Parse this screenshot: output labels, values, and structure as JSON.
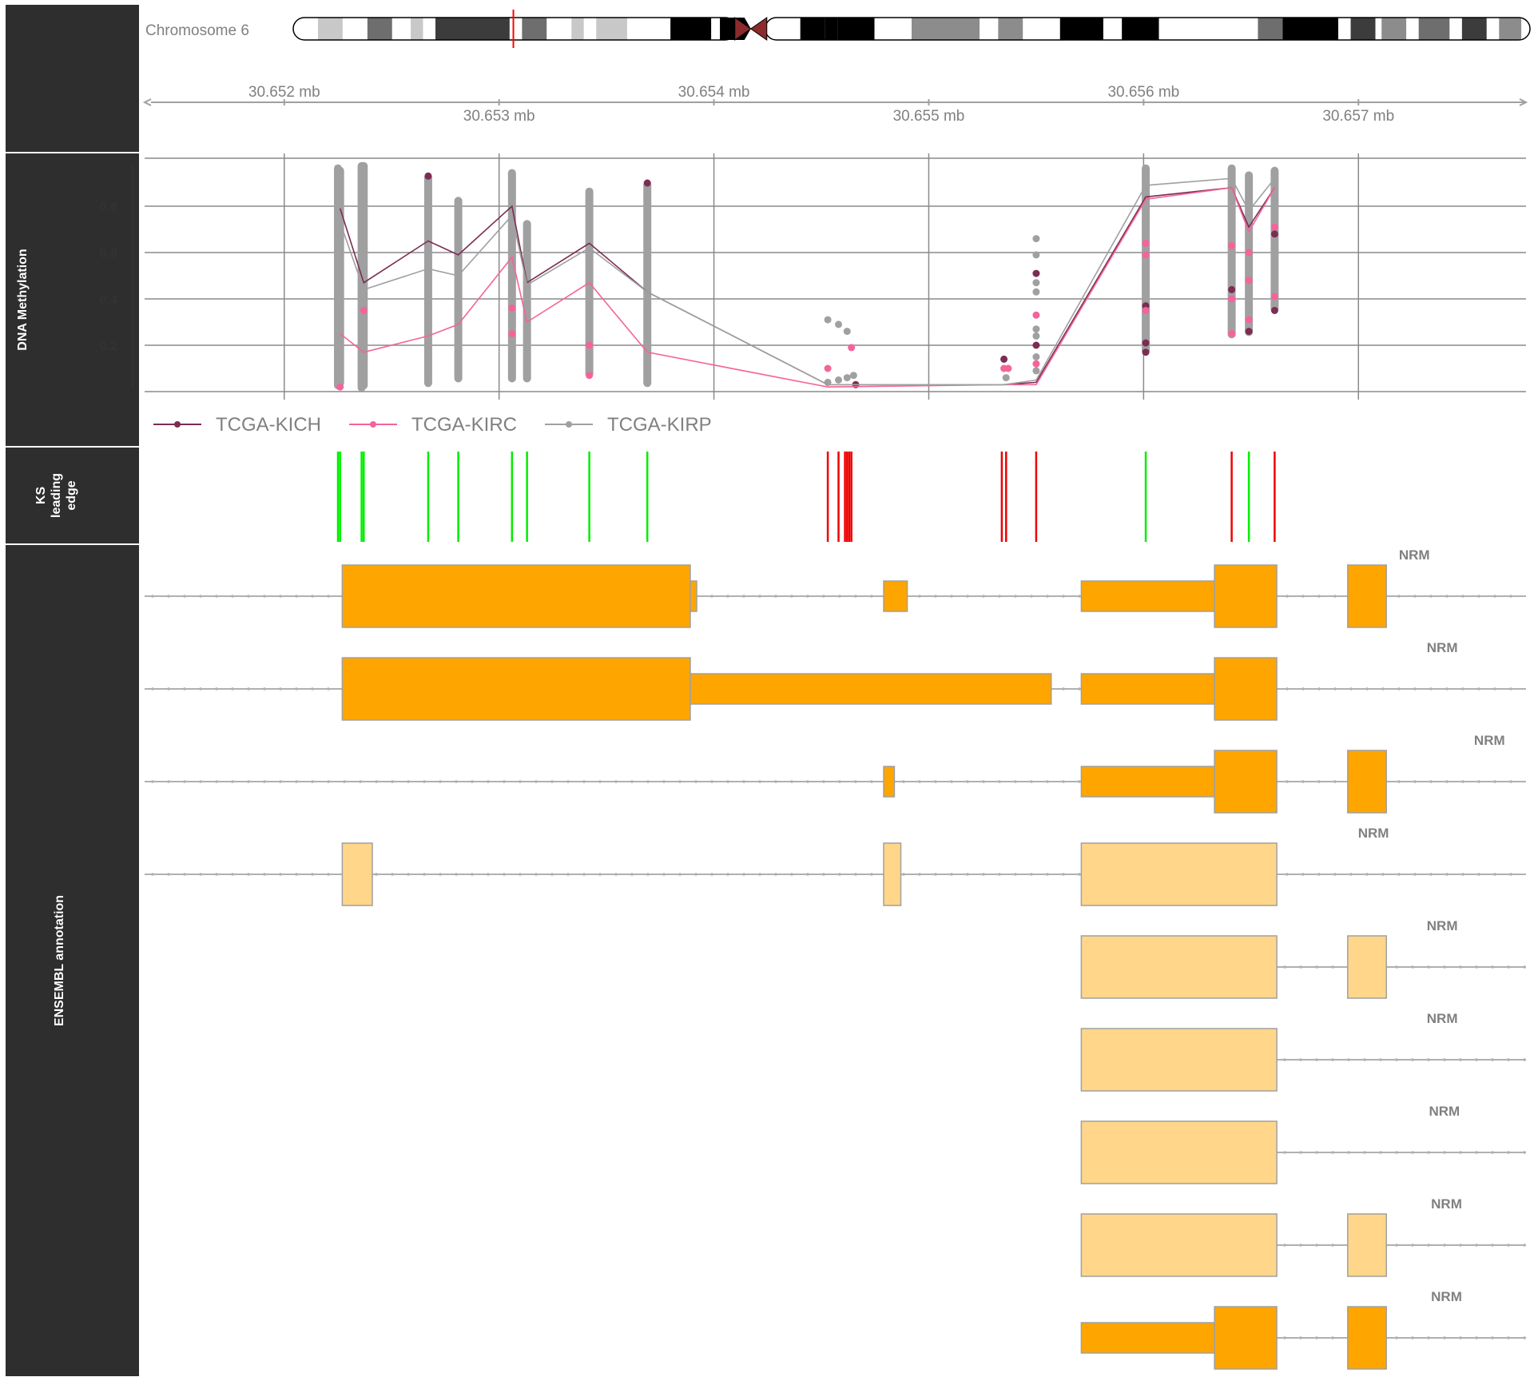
{
  "ideogram": {
    "label": "Chromosome 6",
    "colors": {
      "outline": "#000000",
      "highlight": "#ff0000",
      "centromere": "#8b2b2b"
    },
    "bands": [
      {
        "start": 0.0,
        "end": 0.02,
        "stain": "gneg"
      },
      {
        "start": 0.02,
        "end": 0.04,
        "stain": "gpos25"
      },
      {
        "start": 0.04,
        "end": 0.06,
        "stain": "gneg"
      },
      {
        "start": 0.06,
        "end": 0.08,
        "stain": "gpos75"
      },
      {
        "start": 0.08,
        "end": 0.095,
        "stain": "gneg"
      },
      {
        "start": 0.095,
        "end": 0.105,
        "stain": "gpos25"
      },
      {
        "start": 0.105,
        "end": 0.115,
        "stain": "gneg"
      },
      {
        "start": 0.115,
        "end": 0.175,
        "stain": "gpos90"
      },
      {
        "start": 0.175,
        "end": 0.185,
        "stain": "gneg"
      },
      {
        "start": 0.185,
        "end": 0.205,
        "stain": "gpos75"
      },
      {
        "start": 0.205,
        "end": 0.225,
        "stain": "gneg"
      },
      {
        "start": 0.225,
        "end": 0.235,
        "stain": "gpos25"
      },
      {
        "start": 0.235,
        "end": 0.245,
        "stain": "gneg"
      },
      {
        "start": 0.245,
        "end": 0.27,
        "stain": "gpos25"
      },
      {
        "start": 0.27,
        "end": 0.27,
        "stain": "gneg"
      },
      {
        "start": 0.27,
        "end": 0.305,
        "stain": "gneg"
      },
      {
        "start": 0.305,
        "end": 0.338,
        "stain": "gpos100"
      },
      {
        "start": 0.338,
        "end": 0.345,
        "stain": "gneg"
      },
      {
        "start": 0.345,
        "end": 0.37,
        "stain": "gpos100"
      },
      {
        "start": 0.37,
        "end": 0.38,
        "stain": "gneg"
      },
      {
        "start": 0.41,
        "end": 0.43,
        "stain": "gpos100"
      },
      {
        "start": 0.43,
        "end": 0.44,
        "stain": "gpos100"
      },
      {
        "start": 0.44,
        "end": 0.47,
        "stain": "gpos100"
      },
      {
        "start": 0.47,
        "end": 0.5,
        "stain": "gneg"
      },
      {
        "start": 0.5,
        "end": 0.555,
        "stain": "gpos50"
      },
      {
        "start": 0.555,
        "end": 0.57,
        "stain": "gneg"
      },
      {
        "start": 0.57,
        "end": 0.59,
        "stain": "gpos50"
      },
      {
        "start": 0.59,
        "end": 0.62,
        "stain": "gneg"
      },
      {
        "start": 0.62,
        "end": 0.655,
        "stain": "gpos100"
      },
      {
        "start": 0.655,
        "end": 0.67,
        "stain": "gneg"
      },
      {
        "start": 0.67,
        "end": 0.7,
        "stain": "gpos100"
      },
      {
        "start": 0.7,
        "end": 0.78,
        "stain": "gneg"
      },
      {
        "start": 0.78,
        "end": 0.8,
        "stain": "gpos75"
      },
      {
        "start": 0.8,
        "end": 0.845,
        "stain": "gpos100"
      },
      {
        "start": 0.845,
        "end": 0.855,
        "stain": "gneg"
      },
      {
        "start": 0.855,
        "end": 0.875,
        "stain": "gpos90"
      },
      {
        "start": 0.875,
        "end": 0.88,
        "stain": "gneg"
      },
      {
        "start": 0.88,
        "end": 0.9,
        "stain": "gpos50"
      },
      {
        "start": 0.9,
        "end": 0.91,
        "stain": "gneg"
      },
      {
        "start": 0.91,
        "end": 0.935,
        "stain": "gpos75"
      },
      {
        "start": 0.935,
        "end": 0.945,
        "stain": "gneg"
      },
      {
        "start": 0.945,
        "end": 0.965,
        "stain": "gpos90"
      },
      {
        "start": 0.965,
        "end": 0.975,
        "stain": "gneg"
      },
      {
        "start": 0.975,
        "end": 0.993,
        "stain": "gpos50"
      },
      {
        "start": 0.993,
        "end": 1.0,
        "stain": "gneg"
      }
    ],
    "centromere": 0.37,
    "highlight_at": 0.178
  },
  "stain_colors": {
    "gneg": "#ffffff",
    "gpos25": "#c8c8c8",
    "gpos50": "#8c8c8c",
    "gpos75": "#6e6e6e",
    "gpos90": "#3c3c3c",
    "gpos100": "#000000"
  },
  "axis": {
    "unit": "mb",
    "range": [
      30.65135,
      30.65778
    ],
    "ticks": [
      {
        "value": 30.652,
        "label": "30.652 mb",
        "row": "top"
      },
      {
        "value": 30.653,
        "label": "30.653 mb",
        "row": "bottom"
      },
      {
        "value": 30.654,
        "label": "30.654 mb",
        "row": "top"
      },
      {
        "value": 30.655,
        "label": "30.655 mb",
        "row": "bottom"
      },
      {
        "value": 30.656,
        "label": "30.656 mb",
        "row": "top"
      },
      {
        "value": 30.657,
        "label": "30.657 mb",
        "row": "bottom"
      }
    ]
  },
  "panels": {
    "methylation": "DNA Methylation",
    "ks": [
      "KS",
      "leading",
      "edge"
    ],
    "annotation": "ENSEMBL annotation"
  },
  "chart_data": {
    "type": "line",
    "title": "",
    "xlabel": "",
    "ylabel": "DNA Methylation",
    "ylim": [
      0,
      1
    ],
    "yticks": [
      0.2,
      0.4,
      0.6,
      0.8
    ],
    "grid": true,
    "legend_position": "bottom",
    "x": [
      30.65226,
      30.65237,
      30.65267,
      30.65281,
      30.65306,
      30.65313,
      30.65342,
      30.65369,
      30.65453,
      30.65535,
      30.6555,
      30.65601,
      30.65641,
      30.65649,
      30.65661
    ],
    "series": [
      {
        "name": "TCGA-KICH",
        "color": "#7b2d53",
        "values": [
          0.79,
          0.47,
          0.65,
          0.59,
          0.8,
          0.47,
          0.64,
          0.43,
          0.03,
          0.03,
          0.04,
          0.84,
          0.88,
          0.71,
          0.88
        ]
      },
      {
        "name": "TCGA-KIRC",
        "color": "#f4649a",
        "values": [
          0.25,
          0.17,
          0.24,
          0.29,
          0.58,
          0.3,
          0.47,
          0.17,
          0.02,
          0.03,
          0.03,
          0.83,
          0.88,
          0.69,
          0.88
        ]
      },
      {
        "name": "TCGA-KIRP",
        "color": "#a0a0a0",
        "values": [
          0.73,
          0.44,
          0.53,
          0.5,
          0.76,
          0.46,
          0.62,
          0.43,
          0.03,
          0.03,
          0.05,
          0.89,
          0.92,
          0.78,
          0.92
        ]
      }
    ],
    "scatter_columns": [
      {
        "x": 30.65225,
        "min": 0.02,
        "max": 0.97
      },
      {
        "x": 30.65226,
        "min": 0.03,
        "max": 0.96
      },
      {
        "x": 30.65236,
        "min": 0.01,
        "max": 0.98
      },
      {
        "x": 30.65237,
        "min": 0.02,
        "max": 0.98
      },
      {
        "x": 30.65267,
        "min": 0.03,
        "max": 0.93
      },
      {
        "x": 30.65281,
        "min": 0.05,
        "max": 0.83
      },
      {
        "x": 30.65306,
        "min": 0.05,
        "max": 0.95
      },
      {
        "x": 30.65313,
        "min": 0.05,
        "max": 0.73
      },
      {
        "x": 30.65342,
        "min": 0.07,
        "max": 0.87
      },
      {
        "x": 30.65369,
        "min": 0.03,
        "max": 0.9
      },
      {
        "x": 30.65601,
        "min": 0.17,
        "max": 0.97
      },
      {
        "x": 30.65641,
        "min": 0.24,
        "max": 0.97
      },
      {
        "x": 30.65649,
        "min": 0.25,
        "max": 0.94
      },
      {
        "x": 30.65661,
        "min": 0.35,
        "max": 0.96
      }
    ],
    "scatter_points": [
      {
        "x": 30.65453,
        "y": 0.31,
        "series": 2
      },
      {
        "x": 30.65458,
        "y": 0.29,
        "series": 2
      },
      {
        "x": 30.65462,
        "y": 0.26,
        "series": 2
      },
      {
        "x": 30.65464,
        "y": 0.19,
        "series": 1
      },
      {
        "x": 30.65453,
        "y": 0.1,
        "series": 1
      },
      {
        "x": 30.65453,
        "y": 0.04,
        "series": 2
      },
      {
        "x": 30.65458,
        "y": 0.05,
        "series": 2
      },
      {
        "x": 30.65462,
        "y": 0.06,
        "series": 2
      },
      {
        "x": 30.65465,
        "y": 0.07,
        "series": 2
      },
      {
        "x": 30.65466,
        "y": 0.03,
        "series": 0
      },
      {
        "x": 30.65535,
        "y": 0.14,
        "series": 0
      },
      {
        "x": 30.65535,
        "y": 0.1,
        "series": 1
      },
      {
        "x": 30.65537,
        "y": 0.1,
        "series": 1
      },
      {
        "x": 30.65536,
        "y": 0.06,
        "series": 2
      },
      {
        "x": 30.6555,
        "y": 0.66,
        "series": 2
      },
      {
        "x": 30.6555,
        "y": 0.59,
        "series": 2
      },
      {
        "x": 30.6555,
        "y": 0.51,
        "series": 0
      },
      {
        "x": 30.6555,
        "y": 0.47,
        "series": 2
      },
      {
        "x": 30.6555,
        "y": 0.43,
        "series": 2
      },
      {
        "x": 30.6555,
        "y": 0.33,
        "series": 1
      },
      {
        "x": 30.6555,
        "y": 0.27,
        "series": 2
      },
      {
        "x": 30.6555,
        "y": 0.24,
        "series": 2
      },
      {
        "x": 30.6555,
        "y": 0.2,
        "series": 0
      },
      {
        "x": 30.6555,
        "y": 0.15,
        "series": 2
      },
      {
        "x": 30.6555,
        "y": 0.12,
        "series": 1
      },
      {
        "x": 30.6555,
        "y": 0.09,
        "series": 2
      },
      {
        "x": 30.65601,
        "y": 0.37,
        "series": 0
      },
      {
        "x": 30.65601,
        "y": 0.35,
        "series": 1
      },
      {
        "x": 30.65601,
        "y": 0.21,
        "series": 0
      },
      {
        "x": 30.65601,
        "y": 0.17,
        "series": 0
      },
      {
        "x": 30.65601,
        "y": 0.64,
        "series": 1
      },
      {
        "x": 30.65601,
        "y": 0.59,
        "series": 1
      },
      {
        "x": 30.65641,
        "y": 0.25,
        "series": 1
      },
      {
        "x": 30.65641,
        "y": 0.4,
        "series": 1
      },
      {
        "x": 30.65641,
        "y": 0.44,
        "series": 0
      },
      {
        "x": 30.65641,
        "y": 0.63,
        "series": 1
      },
      {
        "x": 30.65649,
        "y": 0.26,
        "series": 0
      },
      {
        "x": 30.65649,
        "y": 0.31,
        "series": 1
      },
      {
        "x": 30.65649,
        "y": 0.48,
        "series": 1
      },
      {
        "x": 30.65649,
        "y": 0.6,
        "series": 1
      },
      {
        "x": 30.65661,
        "y": 0.35,
        "series": 0
      },
      {
        "x": 30.65661,
        "y": 0.41,
        "series": 1
      },
      {
        "x": 30.65661,
        "y": 0.68,
        "series": 0
      },
      {
        "x": 30.65661,
        "y": 0.71,
        "series": 1
      },
      {
        "x": 30.65226,
        "y": 0.02,
        "series": 1
      },
      {
        "x": 30.65237,
        "y": 0.35,
        "series": 1
      },
      {
        "x": 30.65306,
        "y": 0.36,
        "series": 1
      },
      {
        "x": 30.65306,
        "y": 0.25,
        "series": 1
      },
      {
        "x": 30.65342,
        "y": 0.2,
        "series": 1
      },
      {
        "x": 30.65342,
        "y": 0.07,
        "series": 1
      },
      {
        "x": 30.65369,
        "y": 0.9,
        "series": 0
      },
      {
        "x": 30.65267,
        "y": 0.93,
        "series": 0
      }
    ]
  },
  "ks_edges": {
    "colors": {
      "up": "#00ee00",
      "down": "#ee0000"
    },
    "positions": [
      {
        "x": 30.65225,
        "dir": "up"
      },
      {
        "x": 30.65226,
        "dir": "up"
      },
      {
        "x": 30.65236,
        "dir": "up"
      },
      {
        "x": 30.65237,
        "dir": "up"
      },
      {
        "x": 30.65267,
        "dir": "up"
      },
      {
        "x": 30.65281,
        "dir": "up"
      },
      {
        "x": 30.65306,
        "dir": "up"
      },
      {
        "x": 30.65313,
        "dir": "up"
      },
      {
        "x": 30.65342,
        "dir": "up"
      },
      {
        "x": 30.65369,
        "dir": "up"
      },
      {
        "x": 30.65453,
        "dir": "down"
      },
      {
        "x": 30.65458,
        "dir": "down"
      },
      {
        "x": 30.65461,
        "dir": "down"
      },
      {
        "x": 30.65462,
        "dir": "down"
      },
      {
        "x": 30.65463,
        "dir": "down"
      },
      {
        "x": 30.65464,
        "dir": "down"
      },
      {
        "x": 30.65534,
        "dir": "down"
      },
      {
        "x": 30.65536,
        "dir": "down"
      },
      {
        "x": 30.6555,
        "dir": "down"
      },
      {
        "x": 30.65601,
        "dir": "up"
      },
      {
        "x": 30.65641,
        "dir": "down"
      },
      {
        "x": 30.65649,
        "dir": "up"
      },
      {
        "x": 30.65661,
        "dir": "down"
      }
    ]
  },
  "transcripts": {
    "colors": {
      "coding": "#ffa500",
      "noncoding": "#ffd68a",
      "border": "#a0a0a0",
      "intron": "#b0b0b0"
    },
    "rows": [
      {
        "label": "NRM",
        "label_x": 30.65726,
        "intron": [
          30.65135,
          30.65778
        ],
        "exons": [
          {
            "s": 30.65227,
            "e": 30.65389,
            "t": "cds"
          },
          {
            "s": 30.65389,
            "e": 30.65392,
            "t": "utr"
          },
          {
            "s": 30.65479,
            "e": 30.6549,
            "t": "utr"
          },
          {
            "s": 30.65571,
            "e": 30.65633,
            "t": "utr"
          },
          {
            "s": 30.65633,
            "e": 30.65662,
            "t": "cds"
          },
          {
            "s": 30.65695,
            "e": 30.65713,
            "t": "cds"
          }
        ]
      },
      {
        "label": "NRM",
        "label_x": 30.65739,
        "intron": [
          30.65135,
          30.65778
        ],
        "exons": [
          {
            "s": 30.65227,
            "e": 30.65389,
            "t": "cds"
          },
          {
            "s": 30.65389,
            "e": 30.65557,
            "t": "utr"
          },
          {
            "s": 30.65571,
            "e": 30.65633,
            "t": "utr"
          },
          {
            "s": 30.65633,
            "e": 30.65662,
            "t": "cds"
          }
        ]
      },
      {
        "label": "NRM",
        "label_x": 30.65761,
        "intron": [
          30.65135,
          30.65778
        ],
        "exons": [
          {
            "s": 30.65479,
            "e": 30.65484,
            "t": "utr"
          },
          {
            "s": 30.65571,
            "e": 30.65633,
            "t": "utr"
          },
          {
            "s": 30.65633,
            "e": 30.65662,
            "t": "cds"
          },
          {
            "s": 30.65695,
            "e": 30.65713,
            "t": "cds"
          }
        ]
      },
      {
        "label": "NRM",
        "label_x": 30.65707,
        "intron": [
          30.65135,
          30.65778
        ],
        "exons": [
          {
            "s": 30.65227,
            "e": 30.65241,
            "t": "nc"
          },
          {
            "s": 30.65479,
            "e": 30.65487,
            "t": "nc"
          },
          {
            "s": 30.65571,
            "e": 30.65662,
            "t": "nc"
          }
        ]
      },
      {
        "label": "NRM",
        "label_x": 30.65739,
        "intron": [
          30.65662,
          30.65778
        ],
        "exons": [
          {
            "s": 30.65571,
            "e": 30.65662,
            "t": "nc"
          },
          {
            "s": 30.65695,
            "e": 30.65713,
            "t": "nc"
          }
        ]
      },
      {
        "label": "NRM",
        "label_x": 30.65739,
        "intron": [
          30.65662,
          30.65778
        ],
        "exons": [
          {
            "s": 30.65571,
            "e": 30.65662,
            "t": "nc"
          }
        ]
      },
      {
        "label": "NRM",
        "label_x": 30.6574,
        "intron": [
          30.65662,
          30.65778
        ],
        "exons": [
          {
            "s": 30.65571,
            "e": 30.65662,
            "t": "nc"
          }
        ]
      },
      {
        "label": "NRM",
        "label_x": 30.65741,
        "intron": [
          30.65662,
          30.65778
        ],
        "exons": [
          {
            "s": 30.65571,
            "e": 30.65662,
            "t": "nc"
          },
          {
            "s": 30.65695,
            "e": 30.65713,
            "t": "nc"
          }
        ]
      },
      {
        "label": "NRM",
        "label_x": 30.65741,
        "intron": [
          30.65662,
          30.65778
        ],
        "exons": [
          {
            "s": 30.65571,
            "e": 30.65633,
            "t": "utr"
          },
          {
            "s": 30.65633,
            "e": 30.65662,
            "t": "cds"
          },
          {
            "s": 30.65695,
            "e": 30.65713,
            "t": "cds"
          }
        ]
      }
    ]
  }
}
